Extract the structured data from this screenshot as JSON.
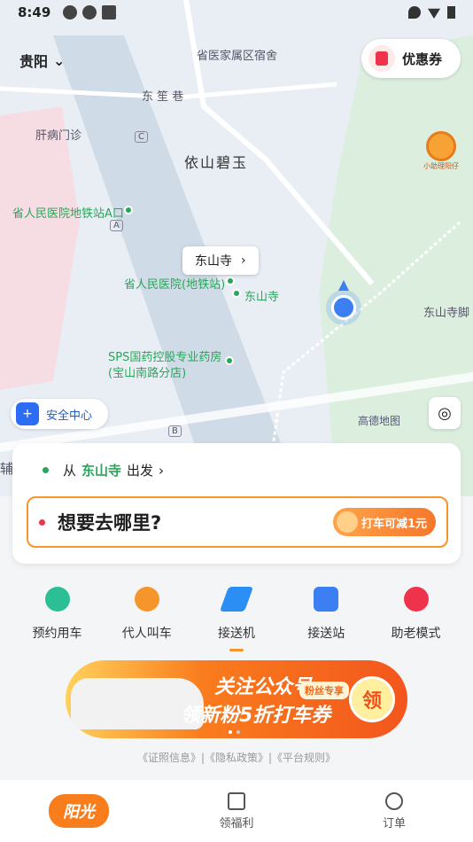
{
  "status_bar": {
    "time": "8:49"
  },
  "header": {
    "city": "贵阳",
    "coupon_label": "优惠券"
  },
  "map": {
    "labels": {
      "dorm": "省医家属区宿舍",
      "lane": "东 笙 巷",
      "clinic": "肝病门诊",
      "compound": "依山碧玉",
      "metro_a": "省人民医院地铁站A口",
      "station": "省人民医院(地铁站)",
      "dongshansi_poi": "东山寺",
      "pharmacy_line1": "SPS国药控股专业药房",
      "pharmacy_line2": "(宝山南路分店)",
      "park_label": "东山寺脚",
      "exit_c": "C",
      "exit_a": "A",
      "exit_b": "B",
      "edge": "辅"
    },
    "callout": "东山寺",
    "safety_center": "安全中心",
    "map_brand": "高德地图",
    "mascot": "小助理阳仔"
  },
  "ride_card": {
    "from_prefix": "从",
    "from_place": "东山寺",
    "from_suffix": "出发",
    "destination_placeholder": "想要去哪里?",
    "promo": "打车可减1元"
  },
  "services": [
    {
      "label": "预约用车",
      "color": "#2bbf95"
    },
    {
      "label": "代人叫车",
      "color": "#f6952c"
    },
    {
      "label": "接送机",
      "color": "#2b8ef5"
    },
    {
      "label": "接送站",
      "color": "#3c7ff2"
    },
    {
      "label": "助老模式",
      "color": "#f0334c"
    }
  ],
  "banner": {
    "line1": "关注公众号",
    "line2": "领新粉5折打车券",
    "tag": "粉丝专享",
    "cta": "领"
  },
  "footer_links": "《证照信息》|《隐私政策》|《平台规则》",
  "tabbar": [
    {
      "label": "阳光",
      "active": true
    },
    {
      "label": "领福利",
      "active": false
    },
    {
      "label": "订单",
      "active": false
    }
  ]
}
